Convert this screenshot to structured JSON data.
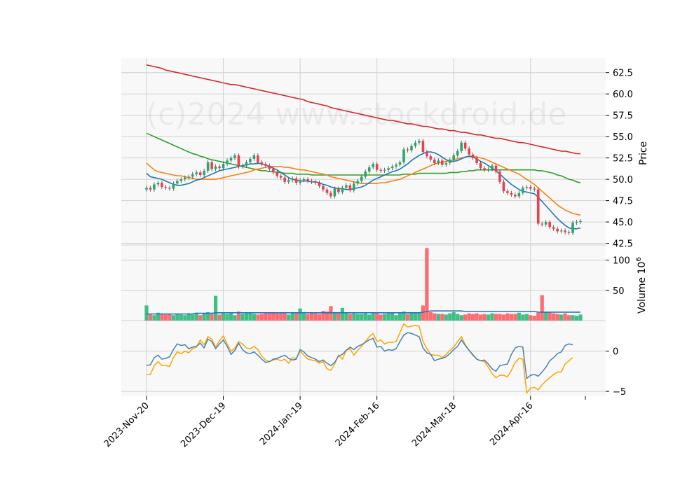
{
  "chart_data": {
    "type": "candlestick",
    "watermark": "(c)2024 www.stockdroid.de",
    "colors": {
      "up": "#26a86b",
      "down": "#ef3e4a",
      "vol_up": "#3fbf86",
      "vol_down": "#ff6b72",
      "ma_fast": "#1f77b4",
      "ma_mid": "#ff7f0e",
      "ma_slow": "#2ca02c",
      "ma_long": "#d62728",
      "osc_a": "#4682b4",
      "osc_b": "#ffa500",
      "panel_bg": "#f8f8f8",
      "grid": "#d0d0d0"
    },
    "x_ticks": [
      "2023-Nov-20",
      "2023-Dec-19",
      "2024-Jan-19",
      "2024-Feb-16",
      "2024-Mar-18",
      "2024-Apr-16"
    ],
    "x_tick_index": [
      0,
      20,
      40,
      60,
      80,
      100
    ],
    "price_panel": {
      "ylabel": "Price",
      "ylim": [
        42.3,
        64.2
      ],
      "ticks": [
        42.5,
        45.0,
        47.5,
        50.0,
        52.5,
        55.0,
        57.5,
        60.0,
        62.5
      ],
      "tick_labels": [
        "42.5",
        "45.0",
        "47.5",
        "50.0",
        "52.5",
        "55.0",
        "57.5",
        "60.0",
        "62.5"
      ],
      "close": [
        49.0,
        48.8,
        49.4,
        49.6,
        49.1,
        49.0,
        48.9,
        49.5,
        49.8,
        50.0,
        50.2,
        50.3,
        50.6,
        50.8,
        50.5,
        51.0,
        52.0,
        51.2,
        51.5,
        51.3,
        51.8,
        52.2,
        52.5,
        52.8,
        51.5,
        51.6,
        52.0,
        52.4,
        52.8,
        52.0,
        51.8,
        51.6,
        51.2,
        50.8,
        50.4,
        50.2,
        49.7,
        49.9,
        50.1,
        49.6,
        49.9,
        50.0,
        49.8,
        49.7,
        49.6,
        49.2,
        48.8,
        48.4,
        48.0,
        48.9,
        48.5,
        49.0,
        49.3,
        48.7,
        49.5,
        49.8,
        50.3,
        50.9,
        51.4,
        51.8,
        51.1,
        51.0,
        51.1,
        51.3,
        51.5,
        51.7,
        52.0,
        53.5,
        53.4,
        53.9,
        54.3,
        54.5,
        53.2,
        52.7,
        52.3,
        51.9,
        52.2,
        51.7,
        51.9,
        52.3,
        52.8,
        53.3,
        54.3,
        53.6,
        52.9,
        52.5,
        51.9,
        51.3,
        51.1,
        51.2,
        51.6,
        50.9,
        49.7,
        48.6,
        48.4,
        48.2,
        48.0,
        48.4,
        49.0,
        49.1,
        48.9,
        48.8,
        44.8,
        44.7,
        45.0,
        44.4,
        44.2,
        43.9,
        44.0,
        43.8,
        43.7,
        44.9,
        45.0,
        45.1
      ],
      "ma_fast": [
        50.7,
        50.3,
        50.2,
        50.1,
        50.0,
        49.8,
        49.6,
        49.4,
        49.3,
        49.3,
        49.4,
        49.5,
        49.7,
        49.9,
        50.0,
        50.2,
        50.4,
        50.6,
        50.8,
        51.0,
        51.1,
        51.2,
        51.3,
        51.4,
        51.5,
        51.6,
        51.7,
        51.8,
        51.8,
        51.9,
        51.8,
        51.7,
        51.5,
        51.3,
        51.1,
        50.8,
        50.5,
        50.2,
        50.0,
        49.9,
        49.8,
        49.8,
        49.8,
        49.7,
        49.7,
        49.6,
        49.4,
        49.3,
        49.1,
        49.0,
        48.9,
        48.9,
        48.8,
        48.8,
        48.9,
        49.0,
        49.1,
        49.3,
        49.6,
        49.9,
        50.1,
        50.3,
        50.5,
        50.7,
        50.9,
        51.0,
        51.2,
        51.5,
        51.8,
        52.2,
        52.5,
        52.8,
        53.0,
        53.2,
        53.2,
        53.1,
        52.9,
        52.6,
        52.3,
        52.1,
        52.1,
        52.2,
        52.4,
        52.6,
        52.7,
        52.6,
        52.4,
        52.1,
        51.9,
        51.6,
        51.3,
        51.0,
        50.6,
        50.2,
        49.8,
        49.4,
        49.1,
        48.8,
        48.6,
        48.5,
        48.4,
        48.3,
        47.9,
        47.4,
        46.9,
        46.4,
        45.9,
        45.4,
        45.0,
        44.6,
        44.3,
        44.2,
        44.2,
        44.3
      ],
      "ma_mid": [
        51.9,
        51.5,
        51.1,
        50.9,
        50.8,
        50.7,
        50.6,
        50.5,
        50.4,
        50.4,
        50.3,
        50.2,
        50.1,
        50.0,
        50.0,
        50.0,
        50.0,
        50.0,
        50.0,
        50.1,
        50.2,
        50.3,
        50.4,
        50.5,
        50.6,
        50.7,
        50.8,
        50.9,
        51.1,
        51.2,
        51.3,
        51.4,
        51.5,
        51.5,
        51.5,
        51.5,
        51.4,
        51.4,
        51.3,
        51.2,
        51.1,
        51.1,
        51.0,
        50.9,
        50.8,
        50.7,
        50.6,
        50.5,
        50.3,
        50.2,
        50.1,
        50.0,
        49.9,
        49.8,
        49.7,
        49.6,
        49.5,
        49.5,
        49.5,
        49.5,
        49.5,
        49.6,
        49.6,
        49.7,
        49.8,
        49.9,
        50.0,
        50.2,
        50.4,
        50.6,
        50.8,
        51.0,
        51.2,
        51.4,
        51.6,
        51.8,
        51.9,
        52.0,
        52.1,
        52.2,
        52.3,
        52.4,
        52.5,
        52.6,
        52.7,
        52.7,
        52.6,
        52.5,
        52.4,
        52.2,
        52.0,
        51.8,
        51.6,
        51.4,
        51.2,
        51.0,
        50.8,
        50.6,
        50.3,
        50.0,
        49.7,
        49.4,
        49.0,
        48.6,
        48.2,
        47.8,
        47.4,
        47.0,
        46.7,
        46.4,
        46.2,
        46.0,
        45.9,
        45.8
      ],
      "ma_slow": [
        55.4,
        55.2,
        55.0,
        54.8,
        54.6,
        54.4,
        54.2,
        54.0,
        53.8,
        53.6,
        53.4,
        53.2,
        53.0,
        52.9,
        52.7,
        52.6,
        52.4,
        52.3,
        52.2,
        52.1,
        52.0,
        51.9,
        51.8,
        51.7,
        51.6,
        51.5,
        51.4,
        51.3,
        51.2,
        51.1,
        51.0,
        51.0,
        50.9,
        50.9,
        50.8,
        50.8,
        50.7,
        50.7,
        50.7,
        50.6,
        50.6,
        50.6,
        50.6,
        50.5,
        50.5,
        50.5,
        50.5,
        50.5,
        50.5,
        50.5,
        50.5,
        50.5,
        50.5,
        50.5,
        50.5,
        50.5,
        50.5,
        50.5,
        50.5,
        50.5,
        50.5,
        50.5,
        50.5,
        50.5,
        50.5,
        50.5,
        50.5,
        50.6,
        50.6,
        50.6,
        50.6,
        50.7,
        50.7,
        50.7,
        50.7,
        50.7,
        50.7,
        50.7,
        50.7,
        50.8,
        50.8,
        50.8,
        50.9,
        50.9,
        51.0,
        51.0,
        51.1,
        51.1,
        51.1,
        51.1,
        51.1,
        51.1,
        51.1,
        51.1,
        51.1,
        51.1,
        51.1,
        51.1,
        51.1,
        51.1,
        51.1,
        51.1,
        51.0,
        51.0,
        50.9,
        50.8,
        50.7,
        50.5,
        50.4,
        50.2,
        50.0,
        49.9,
        49.7,
        49.6
      ],
      "ma_long": [
        63.4,
        63.3,
        63.2,
        63.1,
        63.0,
        62.8,
        62.7,
        62.6,
        62.5,
        62.4,
        62.3,
        62.2,
        62.1,
        62.0,
        61.9,
        61.8,
        61.7,
        61.6,
        61.5,
        61.4,
        61.3,
        61.2,
        61.1,
        61.1,
        61.0,
        60.9,
        60.8,
        60.7,
        60.6,
        60.5,
        60.4,
        60.3,
        60.2,
        60.1,
        60.0,
        59.9,
        59.8,
        59.7,
        59.6,
        59.5,
        59.4,
        59.3,
        59.1,
        59.0,
        58.9,
        58.8,
        58.7,
        58.6,
        58.4,
        58.3,
        58.2,
        58.1,
        58.0,
        57.9,
        57.8,
        57.7,
        57.6,
        57.5,
        57.4,
        57.3,
        57.2,
        57.1,
        57.0,
        56.9,
        56.9,
        56.8,
        56.7,
        56.6,
        56.5,
        56.5,
        56.4,
        56.3,
        56.2,
        56.2,
        56.1,
        56.0,
        55.9,
        55.9,
        55.8,
        55.7,
        55.7,
        55.6,
        55.5,
        55.5,
        55.4,
        55.3,
        55.2,
        55.2,
        55.1,
        55.0,
        54.9,
        54.8,
        54.8,
        54.7,
        54.6,
        54.5,
        54.4,
        54.3,
        54.3,
        54.2,
        54.1,
        54.0,
        53.9,
        53.8,
        53.7,
        53.6,
        53.5,
        53.4,
        53.3,
        53.3,
        53.2,
        53.1,
        53.0,
        53.0
      ]
    },
    "volume_panel": {
      "ylabel": "Volume  10^6",
      "ylim": [
        0,
        125
      ],
      "ticks": [
        50,
        100
      ],
      "tick_labels": [
        "50",
        "100"
      ],
      "volume": [
        25,
        10,
        9,
        13,
        11,
        10,
        11,
        9,
        11,
        10,
        9,
        12,
        10,
        13,
        9,
        12,
        14,
        11,
        41,
        10,
        12,
        11,
        14,
        9,
        15,
        11,
        12,
        13,
        11,
        10,
        11,
        12,
        13,
        14,
        12,
        12,
        13,
        10,
        13,
        12,
        20,
        12,
        11,
        14,
        12,
        11,
        16,
        15,
        24,
        14,
        13,
        21,
        13,
        11,
        12,
        11,
        11,
        12,
        10,
        12,
        12,
        10,
        11,
        12,
        13,
        9,
        12,
        15,
        11,
        13,
        12,
        14,
        25,
        120,
        14,
        12,
        11,
        11,
        10,
        12,
        14,
        11,
        9,
        10,
        12,
        11,
        12,
        10,
        11,
        10,
        12,
        11,
        11,
        10,
        12,
        11,
        11,
        13,
        10,
        11,
        9,
        8,
        13,
        42,
        14,
        14,
        12,
        11,
        10,
        12,
        9,
        9,
        8,
        10
      ],
      "volume_ma": [
        11,
        11,
        11,
        11,
        11,
        11,
        11,
        11,
        11,
        11,
        11,
        11,
        11,
        12,
        12,
        12,
        12,
        12,
        13,
        13,
        13,
        13,
        13,
        13,
        13,
        13,
        13,
        13,
        13,
        13,
        13,
        13,
        13,
        13,
        13,
        13,
        13,
        13,
        13,
        13,
        13,
        13,
        13,
        13,
        13,
        13,
        13,
        13,
        13,
        13,
        13,
        13,
        13,
        13,
        13,
        13,
        13,
        13,
        13,
        13,
        13,
        13,
        13,
        13,
        13,
        13,
        13,
        13,
        13,
        13,
        13,
        13,
        14,
        15,
        16,
        16,
        16,
        16,
        16,
        16,
        16,
        16,
        16,
        15,
        15,
        15,
        15,
        15,
        15,
        15,
        15,
        15,
        15,
        15,
        15,
        15,
        15,
        15,
        15,
        15,
        15,
        15,
        14,
        14,
        14,
        14,
        14,
        14,
        14,
        14,
        14,
        14,
        14,
        14
      ]
    },
    "oscillator_panel": {
      "ylim": [
        -5.6,
        3.8
      ],
      "ticks": [
        -5,
        0
      ],
      "tick_labels": [
        "−5",
        "0"
      ],
      "line_a": [
        -1.8,
        -1.7,
        -0.8,
        -0.5,
        -1.0,
        -0.9,
        -0.7,
        0.2,
        0.9,
        0.7,
        0.8,
        0.3,
        0.5,
        0.6,
        1.0,
        0.4,
        1.5,
        1.2,
        0.3,
        0.9,
        1.4,
        0.6,
        -0.4,
        0.1,
        1.0,
        0.2,
        -0.2,
        -0.3,
        -0.1,
        -0.5,
        -1.0,
        -1.4,
        -1.3,
        -1.0,
        -0.9,
        -0.7,
        -0.5,
        -0.9,
        -1.1,
        -1.0,
        0.2,
        -0.1,
        -0.6,
        -0.8,
        -1.0,
        -1.3,
        -1.1,
        -1.5,
        -1.8,
        -1.4,
        -0.6,
        -0.4,
        0.1,
        0.5,
        0.2,
        0.6,
        0.8,
        1.1,
        1.4,
        1.6,
        0.5,
        0.6,
        0.0,
        0.2,
        0.1,
        0.3,
        1.2,
        2.0,
        2.3,
        2.2,
        2.0,
        1.8,
        0.4,
        -0.2,
        -0.4,
        -1.2,
        -1.0,
        -0.9,
        -0.7,
        -0.3,
        0.2,
        0.6,
        1.4,
        0.7,
        0.1,
        -0.5,
        -1.0,
        -1.2,
        -1.1,
        -1.6,
        -2.2,
        -2.5,
        -1.8,
        -1.7,
        -1.6,
        -0.4,
        0.4,
        0.6,
        0.5,
        -3.4,
        -3.0,
        -2.9,
        -3.1,
        -2.6,
        -2.0,
        -1.2,
        -0.8,
        -0.3,
        -0.1,
        0.7,
        0.9,
        0.8
      ],
      "line_b": [
        -2.9,
        -2.9,
        -1.8,
        -1.3,
        -1.8,
        -1.8,
        -1.9,
        -0.8,
        -0.1,
        -0.3,
        0.0,
        -0.2,
        0.3,
        0.5,
        1.4,
        0.8,
        1.8,
        1.5,
        0.5,
        1.3,
        1.9,
        0.9,
        0.0,
        0.4,
        1.2,
        0.9,
        0.4,
        0.3,
        0.6,
        0.2,
        -0.6,
        -1.1,
        -1.3,
        -1.1,
        -1.0,
        -1.2,
        -1.0,
        -1.5,
        -0.8,
        -0.9,
        0.0,
        -0.5,
        -1.0,
        -1.1,
        -1.2,
        -1.5,
        -1.3,
        -2.2,
        -2.4,
        -1.6,
        -0.5,
        -1.0,
        0.1,
        0.3,
        -0.5,
        0.1,
        0.6,
        1.2,
        1.8,
        2.2,
        1.2,
        1.4,
        0.9,
        1.1,
        1.1,
        1.2,
        2.3,
        3.4,
        3.0,
        3.1,
        3.2,
        3.1,
        1.2,
        0.3,
        -0.4,
        -0.5,
        -0.5,
        -0.8,
        -0.4,
        0.1,
        0.5,
        1.2,
        1.8,
        0.8,
        0.1,
        -0.4,
        -1.0,
        -1.2,
        -1.3,
        -2.0,
        -2.8,
        -3.3,
        -3.0,
        -3.0,
        -3.2,
        -2.4,
        -1.4,
        -0.9,
        -1.0,
        -5.2,
        -4.6,
        -4.5,
        -4.8,
        -4.2,
        -3.7,
        -3.3,
        -2.9,
        -2.6,
        -2.6,
        -1.6,
        -1.2,
        -0.8
      ]
    }
  }
}
